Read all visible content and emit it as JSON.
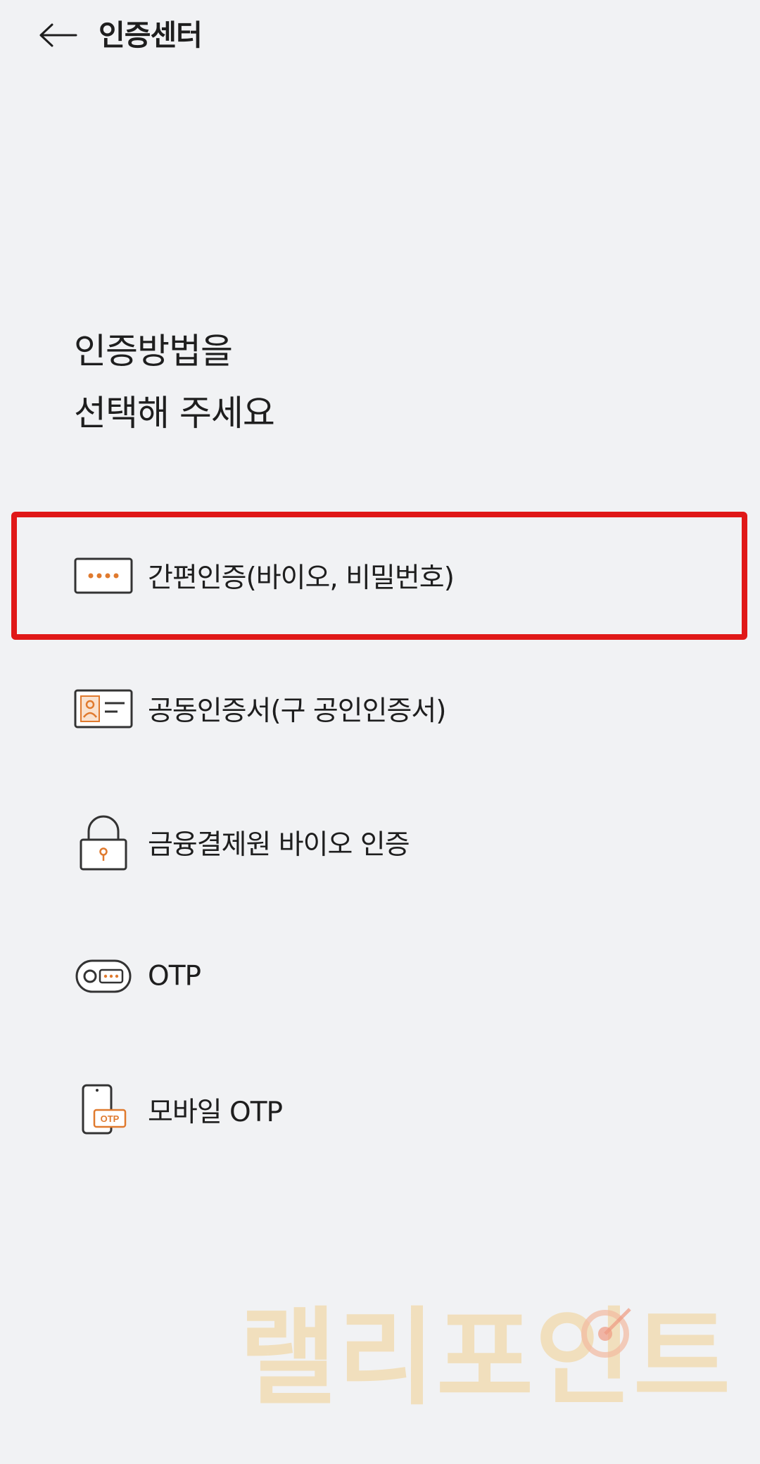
{
  "header": {
    "title": "인증센터"
  },
  "heading": {
    "line1": "인증방법을",
    "line2": "선택해 주세요"
  },
  "menu": [
    {
      "label": "간편인증(바이오, 비밀번호)",
      "icon": "pin-pad-icon"
    },
    {
      "label": "공동인증서(구 공인인증서)",
      "icon": "certificate-card-icon"
    },
    {
      "label": "금융결제원 바이오 인증",
      "icon": "lock-icon"
    },
    {
      "label": "OTP",
      "icon": "otp-token-icon"
    },
    {
      "label": "모바일 OTP",
      "icon": "mobile-otp-icon"
    }
  ],
  "mobile_otp_badge": "OTP",
  "watermark": "랠리포인트",
  "colors": {
    "accent": "#e07a2e",
    "highlight": "#e01818",
    "background": "#f1f2f4"
  }
}
